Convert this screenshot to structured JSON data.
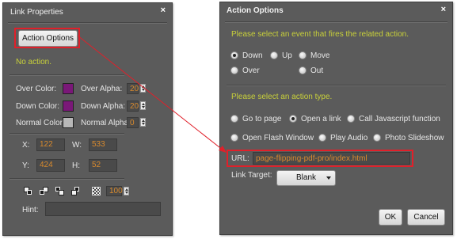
{
  "link_properties": {
    "title": "Link Properties",
    "close_glyph": "×",
    "action_options_button": "Action Options",
    "status": "No action.",
    "over_color_label": "Over Color:",
    "down_color_label": "Down Color:",
    "normal_color_label": "Normal Color:",
    "over_color": "#7a1878",
    "down_color": "#7a1878",
    "normal_color": "#b8b8b8",
    "over_alpha_label": "Over Alpha:",
    "down_alpha_label": "Down Alpha:",
    "normal_alpha_label": "Normal Alpha:",
    "over_alpha": "20",
    "down_alpha": "20",
    "normal_alpha": "0",
    "x_label": "X:",
    "x_value": "122",
    "w_label": "W:",
    "w_value": "533",
    "y_label": "Y:",
    "y_value": "424",
    "h_label": "H:",
    "h_value": "52",
    "opacity_value": "100",
    "hint_label": "Hint:",
    "hint_value": ""
  },
  "action_options": {
    "title": "Action Options",
    "close_glyph": "×",
    "event_prompt": "Please select an event that fires the related action.",
    "events": [
      {
        "label": "Down",
        "selected": true
      },
      {
        "label": "Up",
        "selected": false
      },
      {
        "label": "Move",
        "selected": false
      },
      {
        "label": "Over",
        "selected": false
      },
      {
        "label": "Out",
        "selected": false
      }
    ],
    "action_prompt": "Please select an action type.",
    "actions": [
      {
        "label": "Go to page",
        "selected": false
      },
      {
        "label": "Open a link",
        "selected": true
      },
      {
        "label": "Call Javascript function",
        "selected": false
      },
      {
        "label": "Open Flash Window",
        "selected": false
      },
      {
        "label": "Play Audio",
        "selected": false
      },
      {
        "label": "Photo Slideshow",
        "selected": false
      }
    ],
    "url_label": "URL:",
    "url_value": "page-flipping-pdf-pro/index.html",
    "link_target_label": "Link Target:",
    "link_target_value": "Blank",
    "ok_label": "OK",
    "cancel_label": "Cancel"
  },
  "colors": {
    "highlight_red": "#e0202a",
    "prompt_yellow": "#c9d13a",
    "value_orange": "#d88a2e"
  }
}
